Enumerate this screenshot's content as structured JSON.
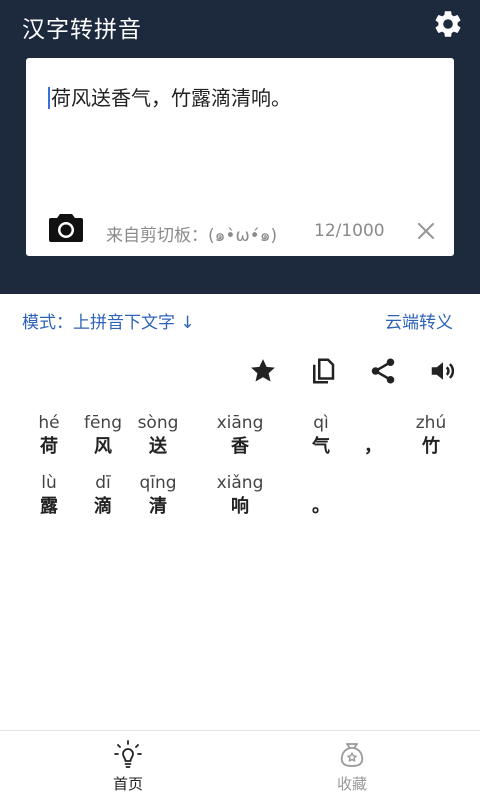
{
  "app": {
    "title": "汉字转拼音",
    "settings_icon": "gear-icon"
  },
  "input": {
    "value": "荷风送香气，竹露滴清响。",
    "clipboard_text": "来自剪切板：(๑•̀ω•́๑)",
    "char_count": "12/1000",
    "camera_icon": "camera-icon",
    "clear_icon": "close-icon"
  },
  "options": {
    "mode_label": "模式：上拼音下文字 ↓",
    "cloud_label": "云端转义"
  },
  "toolbar": {
    "icons": [
      "star-icon",
      "copy-icon",
      "share-icon",
      "volume-icon"
    ]
  },
  "result": {
    "rows": [
      [
        {
          "pinyin": "hé",
          "hanzi": "荷"
        },
        {
          "pinyin": "fēng",
          "hanzi": "风"
        },
        {
          "pinyin": "sòng",
          "hanzi": "送"
        },
        {
          "pinyin": "xiāng",
          "hanzi": "香"
        },
        {
          "pinyin": "qì",
          "hanzi": "气"
        },
        {
          "pinyin": "",
          "hanzi": "，"
        },
        {
          "pinyin": "zhú",
          "hanzi": "竹"
        }
      ],
      [
        {
          "pinyin": "lù",
          "hanzi": "露"
        },
        {
          "pinyin": "dī",
          "hanzi": "滴"
        },
        {
          "pinyin": "qīng",
          "hanzi": "清"
        },
        {
          "pinyin": "xiǎng",
          "hanzi": "响"
        },
        {
          "pinyin": "",
          "hanzi": "。"
        }
      ]
    ]
  },
  "tabs": [
    {
      "label": "首页",
      "icon": "lightbulb-icon",
      "active": true,
      "color": "#222222"
    },
    {
      "label": "收藏",
      "icon": "favorites-bag-icon",
      "active": false,
      "color": "#9a9a9a"
    }
  ],
  "colors": {
    "header_bg": "#1d2a3e",
    "accent": "#2e63b8",
    "caret": "#3a6fd8"
  }
}
